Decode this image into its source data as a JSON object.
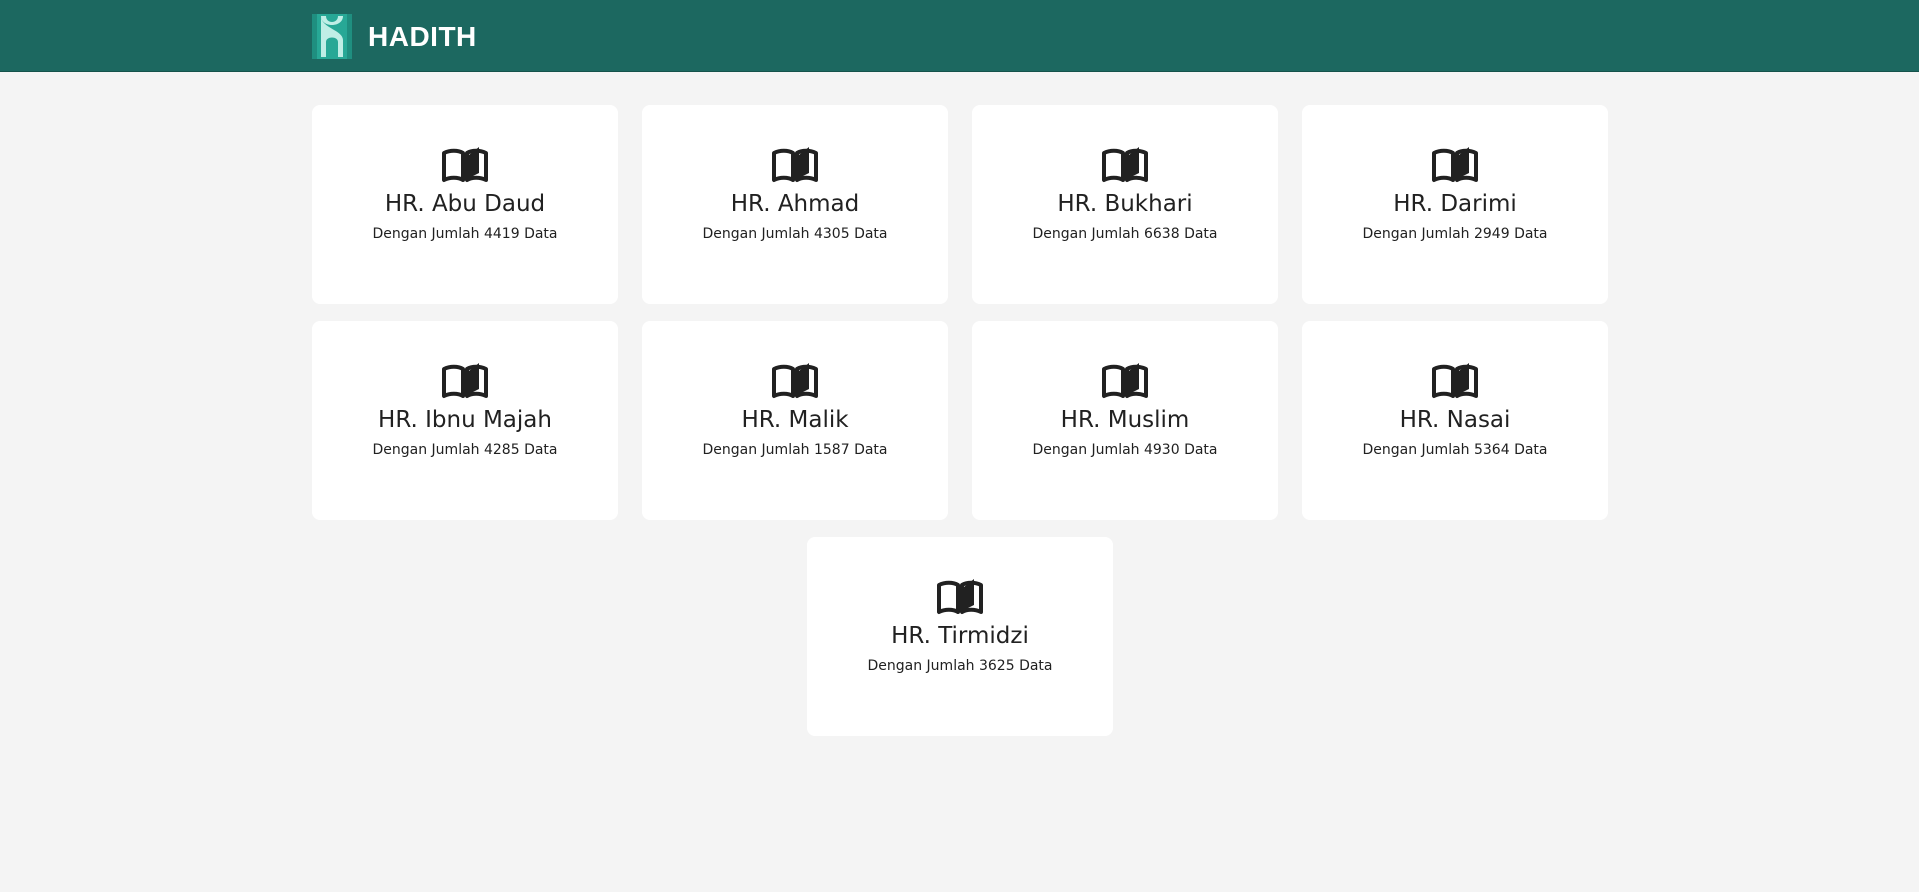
{
  "header": {
    "brand": "HADITH",
    "logo_color": "#2ab3a0",
    "bar_color": "#1c6860"
  },
  "collections": [
    {
      "title": "HR. Abu Daud",
      "subtitle": "Dengan Jumlah 4419 Data",
      "icon": "book-open-icon"
    },
    {
      "title": "HR. Ahmad",
      "subtitle": "Dengan Jumlah 4305 Data",
      "icon": "book-open-icon"
    },
    {
      "title": "HR. Bukhari",
      "subtitle": "Dengan Jumlah 6638 Data",
      "icon": "book-open-icon"
    },
    {
      "title": "HR. Darimi",
      "subtitle": "Dengan Jumlah 2949 Data",
      "icon": "book-open-icon"
    },
    {
      "title": "HR. Ibnu Majah",
      "subtitle": "Dengan Jumlah 4285 Data",
      "icon": "book-open-icon"
    },
    {
      "title": "HR. Malik",
      "subtitle": "Dengan Jumlah 1587 Data",
      "icon": "book-open-icon"
    },
    {
      "title": "HR. Muslim",
      "subtitle": "Dengan Jumlah 4930 Data",
      "icon": "book-open-icon"
    },
    {
      "title": "HR. Nasai",
      "subtitle": "Dengan Jumlah 5364 Data",
      "icon": "book-open-icon"
    },
    {
      "title": "HR. Tirmidzi",
      "subtitle": "Dengan Jumlah 3625 Data",
      "icon": "book-open-icon"
    }
  ]
}
